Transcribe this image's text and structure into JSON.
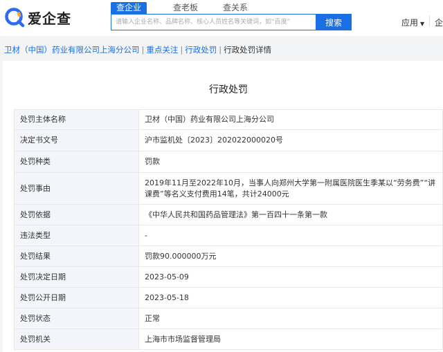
{
  "logo": {
    "text": "爱企查",
    "brand_color": "#2d6bf0"
  },
  "search": {
    "tabs": [
      {
        "label": "查企业",
        "active": true
      },
      {
        "label": "查老板",
        "active": false
      },
      {
        "label": "查关系",
        "active": false
      }
    ],
    "placeholder": "请输入企业名称、品牌名称、核心人员姓名等关键词，如“百度”",
    "button_label": "搜索"
  },
  "header_right": {
    "app_label": "应用",
    "caret": "▼",
    "enterprise_label": "企"
  },
  "breadcrumb": [
    {
      "label": "卫材（中国）药业有限公司上海分公司",
      "link": true
    },
    {
      "label": "重点关注",
      "link": true
    },
    {
      "label": "行政处罚",
      "link": true
    },
    {
      "label": "行政处罚详情",
      "link": false
    }
  ],
  "page_title": "行政处罚",
  "rows": [
    {
      "label": "处罚主体名称",
      "value": "卫材（中国）药业有限公司上海分公司"
    },
    {
      "label": "决定书文号",
      "value": "沪市监机处〔2023〕202022000020号"
    },
    {
      "label": "处罚种类",
      "value": "罚款"
    },
    {
      "label": "处罚事由",
      "value": "2019年11月至2022年10月，当事人向郑州大学第一附属医院医生季某以“劳务费”“讲课费”等名义支付费用14笔，共计24000元"
    },
    {
      "label": "处罚依据",
      "value": "《中华人民共和国药品管理法》第一百四十一条第一款"
    },
    {
      "label": "违法类型",
      "value": "-"
    },
    {
      "label": "处罚结果",
      "value": "罚款90.000000万元"
    },
    {
      "label": "处罚决定日期",
      "value": "2023-05-09"
    },
    {
      "label": "处罚公开日期",
      "value": "2023-05-18"
    },
    {
      "label": "处罚状态",
      "value": "正常"
    },
    {
      "label": "处罚机关",
      "value": "上海市市场监督管理局"
    }
  ]
}
